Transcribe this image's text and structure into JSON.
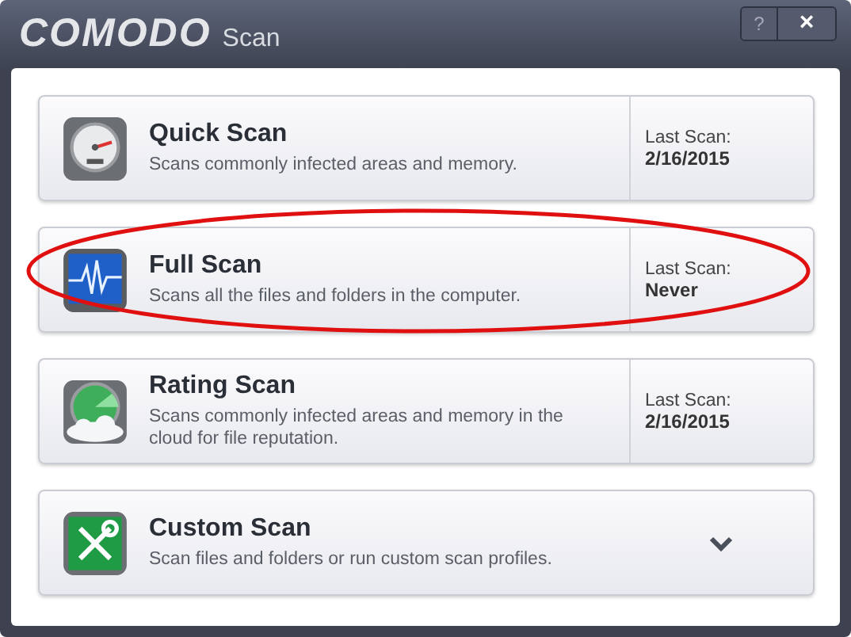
{
  "window": {
    "logo": "COMODO",
    "title": "Scan",
    "buttons": [
      "?",
      "×"
    ]
  },
  "scans": [
    {
      "kind": "last_scan",
      "title": "Quick Scan",
      "description": "Scans commonly infected areas and memory.",
      "last_label": "Last Scan:",
      "last_value": "2/16/2015",
      "highlighted": false
    },
    {
      "kind": "last_scan",
      "title": "Full Scan",
      "description": "Scans all the files and folders in the computer.",
      "last_label": "Last Scan:",
      "last_value": "Never",
      "highlighted": true
    },
    {
      "kind": "last_scan",
      "title": "Rating Scan",
      "description": "Scans commonly infected areas and memory in the cloud for file reputation.",
      "last_label": "Last Scan:",
      "last_value": "2/16/2015",
      "highlighted": false
    },
    {
      "kind": "expand",
      "title": "Custom Scan",
      "description": "Scan files and folders or run custom scan profiles.",
      "highlighted": false
    }
  ]
}
